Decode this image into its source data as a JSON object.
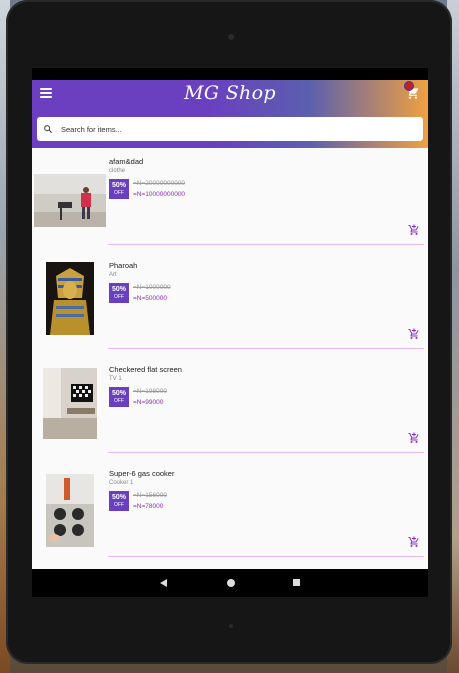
{
  "app": {
    "title": "MG Shop"
  },
  "search": {
    "placeholder": "Search for items..."
  },
  "products": [
    {
      "name": "afam&dad",
      "category": "clothe",
      "discount": "50%",
      "off_label": "OFF",
      "old_price": "=N=20000000000",
      "new_price": "=N=10000000000",
      "image": "room-photo"
    },
    {
      "name": "Pharoah",
      "category": "Art",
      "discount": "50%",
      "off_label": "OFF",
      "old_price": "=N=1000000",
      "new_price": "=N=500000",
      "image": "pharaoh-statue"
    },
    {
      "name": "Checkered flat screen",
      "category": "TV 1",
      "discount": "50%",
      "off_label": "OFF",
      "old_price": "=N=198000",
      "new_price": "=N=99000",
      "image": "tv-room"
    },
    {
      "name": "Super-6 gas cooker",
      "category": "Cooker 1",
      "discount": "50%",
      "off_label": "OFF",
      "old_price": "=N=156000",
      "new_price": "=N=78000",
      "image": "gas-cooker"
    }
  ],
  "icons": {
    "menu": "menu-icon",
    "cart": "cart-icon",
    "search": "search-icon",
    "add_to_cart": "add-cart-icon"
  },
  "colors": {
    "accent": "#6a3fbf",
    "price": "#8a2fbf",
    "gradient_end": "#f0a040"
  }
}
